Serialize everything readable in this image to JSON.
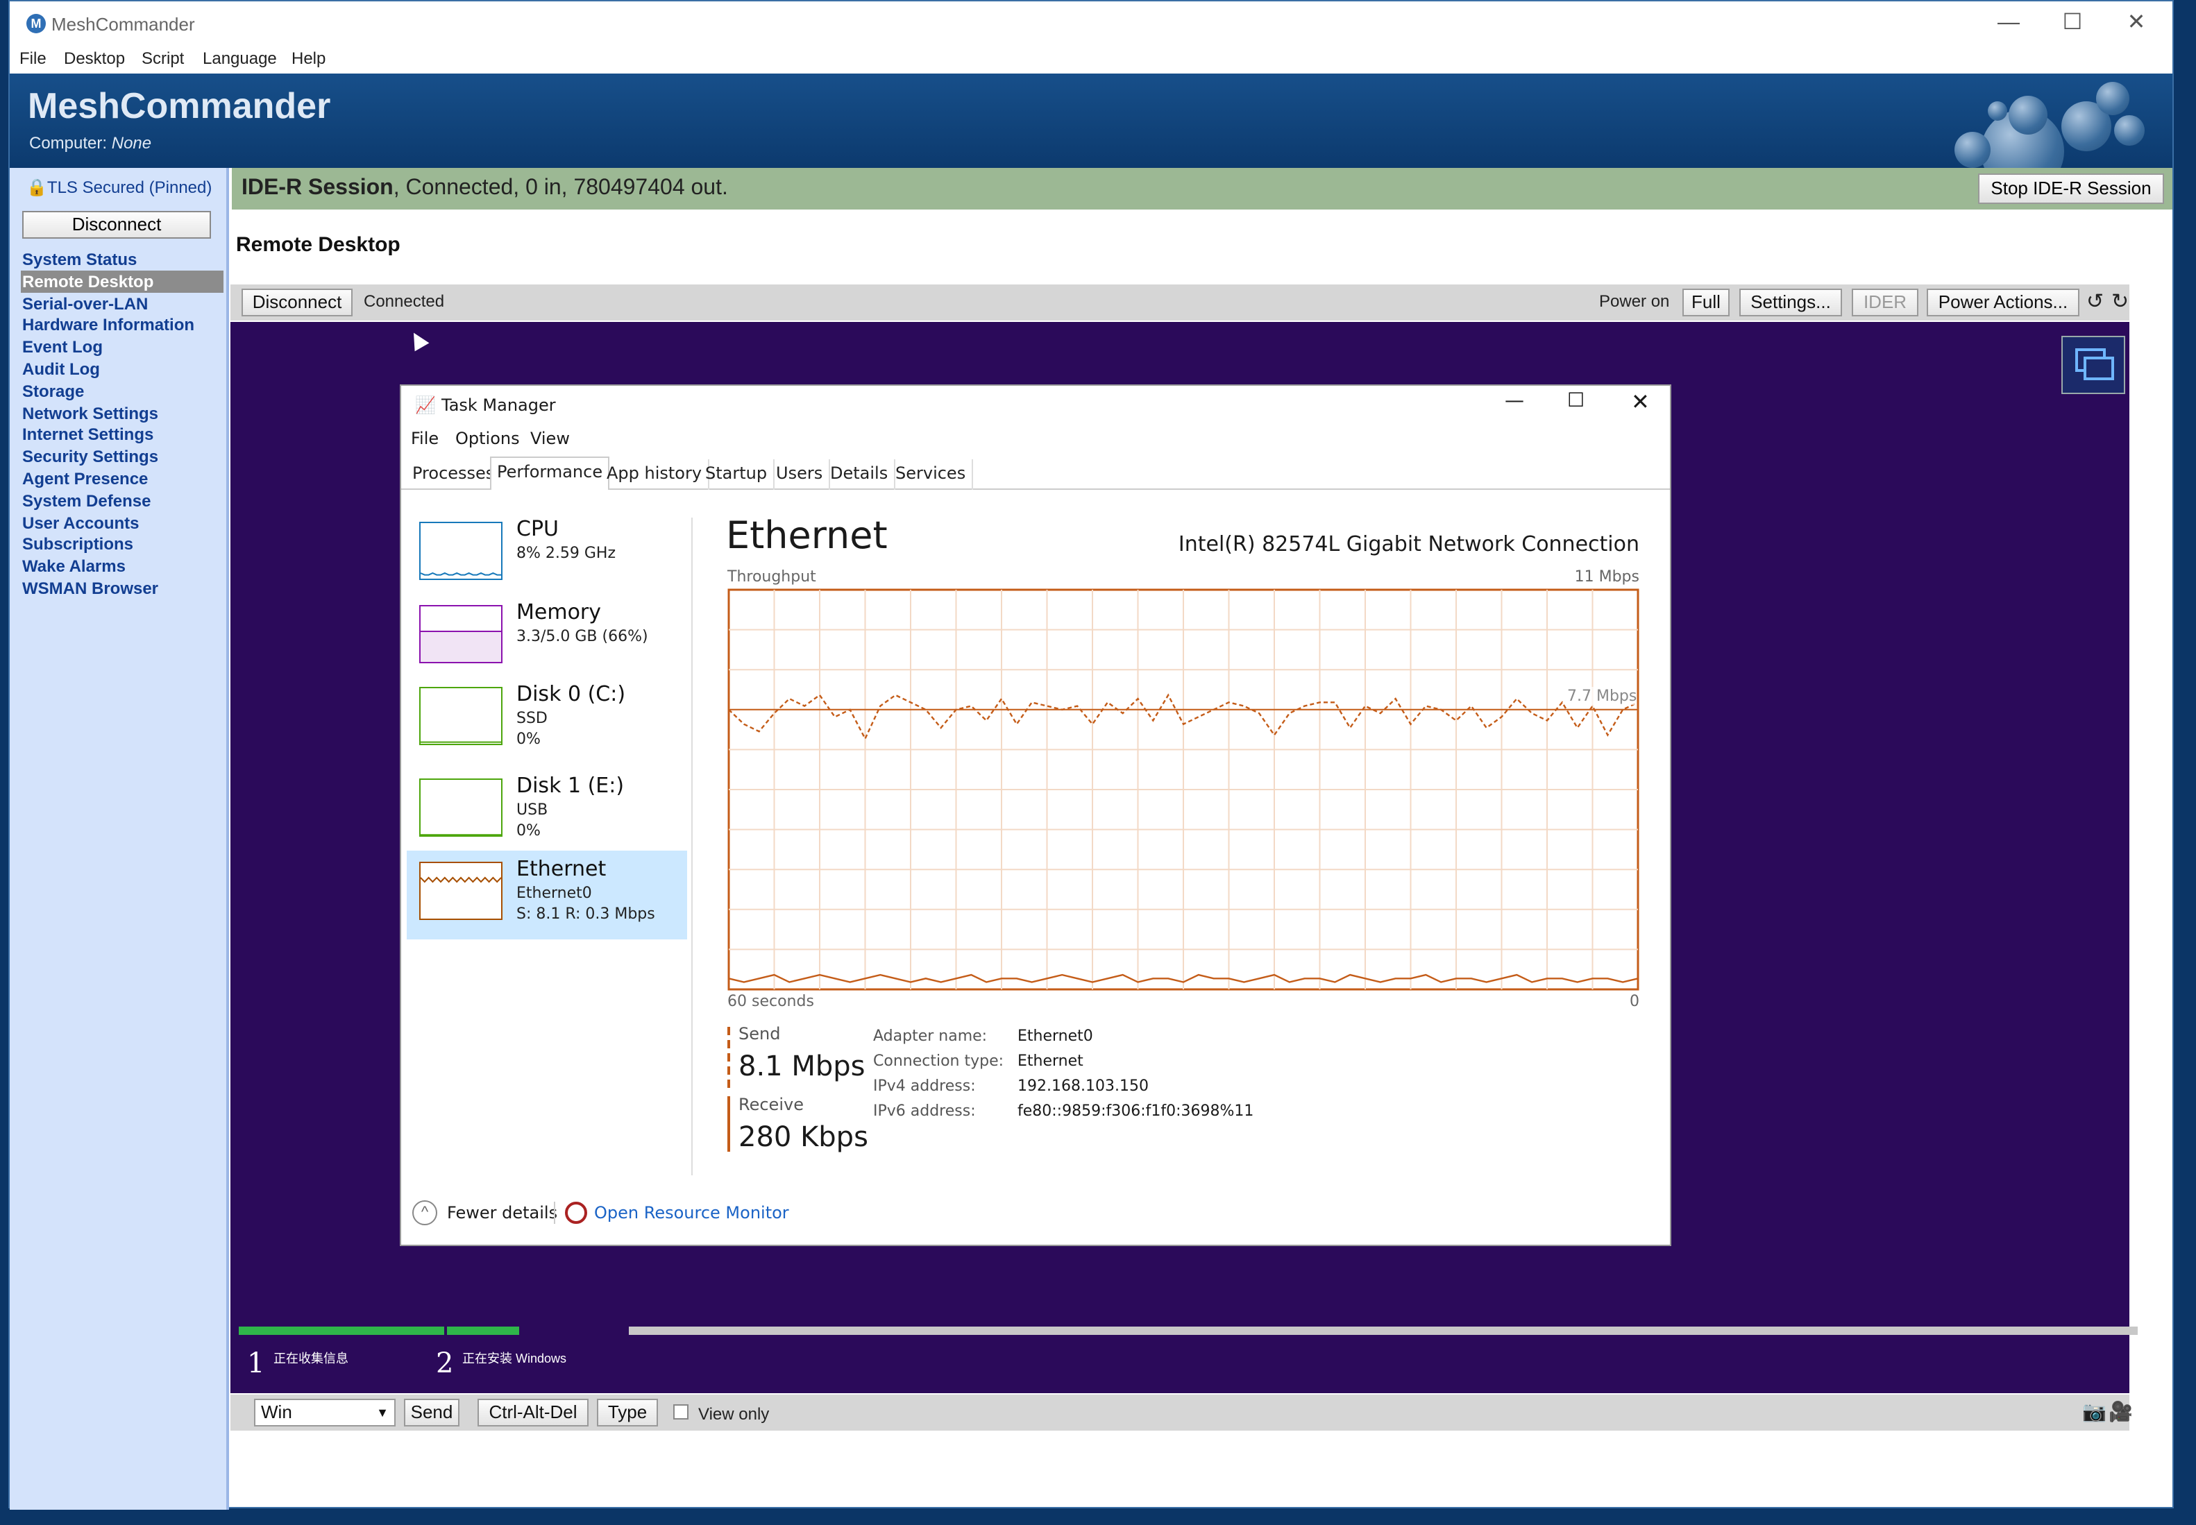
{
  "window": {
    "title": "MeshCommander",
    "icon": "meshcommander-icon"
  },
  "menu": [
    "File",
    "Desktop",
    "Script",
    "Language",
    "Help"
  ],
  "banner": {
    "brand": "MeshCommander",
    "computer_label": "Computer:",
    "computer_value": "None"
  },
  "sidebar": {
    "tls": "TLS Secured (Pinned)",
    "disconnect": "Disconnect",
    "items": [
      "System Status",
      "Remote Desktop",
      "Serial-over-LAN",
      "Hardware Information",
      "Event Log",
      "Audit Log",
      "Storage",
      "Network Settings",
      "Internet Settings",
      "Security Settings",
      "Agent Presence",
      "System Defense",
      "User Accounts",
      "Subscriptions",
      "Wake Alarms",
      "WSMAN Browser"
    ],
    "selected_index": 1
  },
  "ider": {
    "title": "IDE-R Session",
    "status": ", Connected, 0 in, 780497404 out.",
    "stop": "Stop IDE-R Session"
  },
  "remote_desktop": {
    "title": "Remote Desktop",
    "disconnect": "Disconnect",
    "state": "Connected",
    "power_label": "Power on",
    "full": "Full",
    "settings": "Settings...",
    "ider": "IDER",
    "power_actions": "Power Actions..."
  },
  "task_manager": {
    "title": "Task Manager",
    "menu": [
      "File",
      "Options",
      "View"
    ],
    "tabs": [
      "Processes",
      "Performance",
      "App history",
      "Startup",
      "Users",
      "Details",
      "Services"
    ],
    "selected_tab": 1,
    "resources": [
      {
        "name": "CPU",
        "lines": [
          "8% 2.59 GHz"
        ],
        "color": "#1779ba"
      },
      {
        "name": "Memory",
        "lines": [
          "3.3/5.0 GB (66%)"
        ],
        "color": "#8b12ae"
      },
      {
        "name": "Disk 0 (C:)",
        "lines": [
          "SSD",
          "0%"
        ],
        "color": "#4da60c"
      },
      {
        "name": "Disk 1 (E:)",
        "lines": [
          "USB",
          "0%"
        ],
        "color": "#4da60c"
      },
      {
        "name": "Ethernet",
        "lines": [
          "Ethernet0",
          "S: 8.1  R: 0.3 Mbps"
        ],
        "color": "#a74f01"
      }
    ],
    "selected_resource": 4,
    "detail": {
      "title": "Ethernet",
      "adapter": "Intel(R) 82574L Gigabit Network Connection",
      "graph_label": "Throughput",
      "graph_max": "11 Mbps",
      "graph_mid": "7.7 Mbps",
      "time_left": "60 seconds",
      "time_right": "0",
      "send_label": "Send",
      "send_value": "8.1 Mbps",
      "receive_label": "Receive",
      "receive_value": "280 Kbps",
      "props": [
        {
          "k": "Adapter name:",
          "v": "Ethernet0"
        },
        {
          "k": "Connection type:",
          "v": "Ethernet"
        },
        {
          "k": "IPv4 address:",
          "v": "192.168.103.150"
        },
        {
          "k": "IPv6 address:",
          "v": "fe80::9859:f306:f1f0:3698%11"
        }
      ]
    },
    "fewer_details": "Fewer details",
    "open_resource_monitor": "Open Resource Monitor"
  },
  "chart_data": {
    "type": "line",
    "title": "Throughput",
    "ylim": [
      0,
      11
    ],
    "x": [
      0,
      1,
      2,
      3,
      4,
      5,
      6,
      7,
      8,
      9,
      10,
      11,
      12,
      13,
      14,
      15,
      16,
      17,
      18,
      19,
      20,
      21,
      22,
      23,
      24,
      25,
      26,
      27,
      28,
      29,
      30,
      31,
      32,
      33,
      34,
      35,
      36,
      37,
      38,
      39,
      40,
      41,
      42,
      43,
      44,
      45,
      46,
      47,
      48,
      49,
      50,
      51,
      52,
      53,
      54,
      55,
      56,
      57,
      58,
      59,
      60
    ],
    "series": [
      {
        "values": [
          7.7,
          7.3,
          7.1,
          7.6,
          8.0,
          7.8,
          8.1,
          7.5,
          7.7,
          6.9,
          7.8,
          8.1,
          7.9,
          7.7,
          7.2,
          7.7,
          7.8,
          7.4,
          8.0,
          7.3,
          7.9,
          7.8,
          7.7,
          7.8,
          7.3,
          7.9,
          7.6,
          8.0,
          7.4,
          8.1,
          7.3,
          7.5,
          7.7,
          7.9,
          7.8,
          7.6,
          7.0,
          7.6,
          7.8,
          7.9,
          7.9,
          7.2,
          7.8,
          7.6,
          8.0,
          7.3,
          7.8,
          7.7,
          7.4,
          7.8,
          7.2,
          7.5,
          8.0,
          7.6,
          7.4,
          7.9,
          7.2,
          7.8,
          7.0,
          7.7,
          7.9
        ]
      },
      {
        "values": [
          0.3,
          0.2,
          0.3,
          0.4,
          0.2,
          0.3,
          0.4,
          0.3,
          0.2,
          0.3,
          0.4,
          0.3,
          0.2,
          0.3,
          0.2,
          0.3,
          0.4,
          0.2,
          0.3,
          0.3,
          0.2,
          0.3,
          0.4,
          0.3,
          0.2,
          0.3,
          0.4,
          0.2,
          0.3,
          0.3,
          0.2,
          0.4,
          0.3,
          0.3,
          0.2,
          0.3,
          0.4,
          0.2,
          0.3,
          0.3,
          0.2,
          0.4,
          0.3,
          0.2,
          0.3,
          0.3,
          0.4,
          0.2,
          0.3,
          0.3,
          0.2,
          0.3,
          0.4,
          0.2,
          0.3,
          0.3,
          0.2,
          0.3,
          0.3,
          0.2,
          0.3
        ]
      }
    ],
    "color": "#c45c18"
  },
  "setup_steps": [
    {
      "num": "1",
      "label": "正在收集信息"
    },
    {
      "num": "2",
      "label": "正在安装 Windows"
    }
  ],
  "setup_progress": [
    1.0,
    0.4
  ],
  "bottom": {
    "key_select": "Win",
    "send": "Send",
    "cad": "Ctrl-Alt-Del",
    "type": "Type",
    "view_only": "View only"
  }
}
